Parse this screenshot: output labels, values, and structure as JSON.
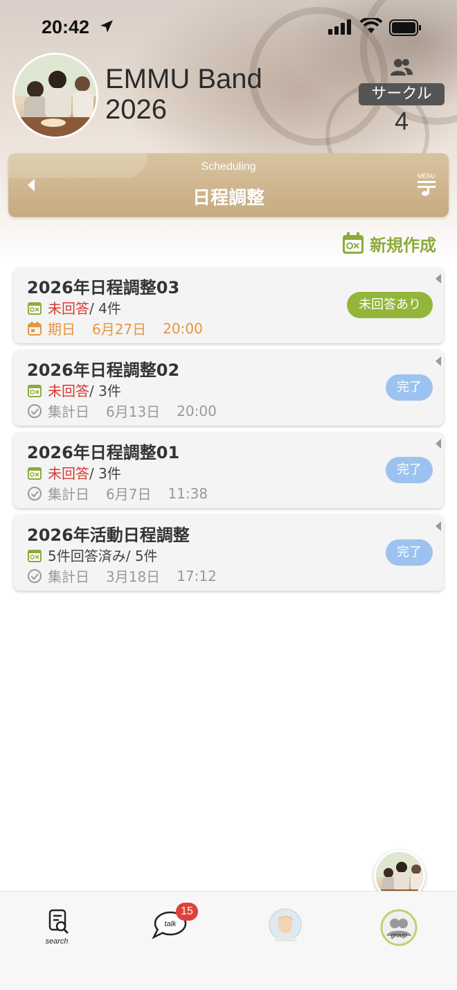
{
  "status": {
    "time": "20:42"
  },
  "group": {
    "title_line1": "EMMU Band",
    "title_line2": "2026",
    "circle_label": "サークル",
    "member_count": "4"
  },
  "nav": {
    "subtitle": "Scheduling",
    "title": "日程調整",
    "menu_label": "MENU"
  },
  "new_button": {
    "label": "新規作成"
  },
  "colors": {
    "accent_green": "#93b63a",
    "pending_red": "#d63a2e",
    "deadline_orange": "#e8953c",
    "done_blue": "#9cc3ef",
    "nav_gold": "#c7ab80"
  },
  "schedules": [
    {
      "title": "2026年日程調整03",
      "status_text": "未回答",
      "count_text": " / 4件",
      "date_label": "期日",
      "date": "6月27日",
      "time": "20:00",
      "badge": "未回答あり"
    },
    {
      "title": "2026年日程調整02",
      "status_text": "未回答",
      "count_text": " / 3件",
      "date_label": "集計日",
      "date": "6月13日",
      "time": "20:00",
      "badge": "完了"
    },
    {
      "title": "2026年日程調整01",
      "status_text": "未回答",
      "count_text": " / 3件",
      "date_label": "集計日",
      "date": "6月7日",
      "time": "11:38",
      "badge": "完了"
    },
    {
      "title": "2026年活動日程調整",
      "status_text": "5件回答済み",
      "count_text": " / 5件",
      "date_label": "集計日",
      "date": "3月18日",
      "time": "17:12",
      "badge": "完了"
    }
  ],
  "tabbar": {
    "search_label": "search",
    "talk_label": "talk",
    "talk_badge": "15",
    "group_label": "group"
  }
}
